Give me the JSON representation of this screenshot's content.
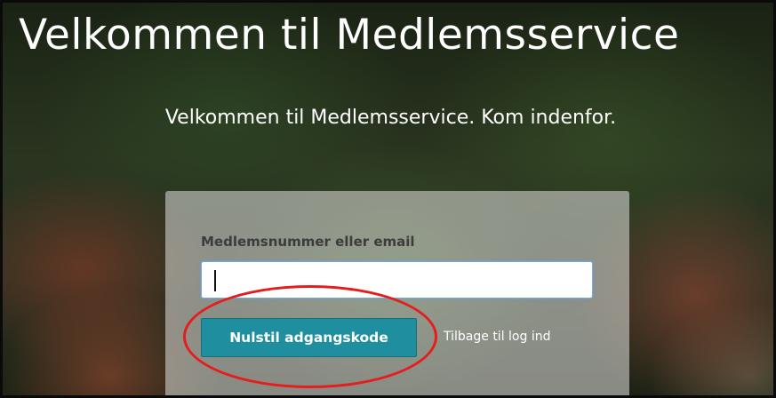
{
  "page": {
    "heading": "Velkommen til Medlemsservice",
    "subheading": "Velkommen til Medlemsservice. Kom indenfor."
  },
  "form": {
    "field_label": "Medlemsnummer eller email",
    "input_value": "",
    "reset_button_label": "Nulstil adgangskode",
    "back_link_label": "Tilbage til log ind"
  },
  "colors": {
    "button": "#1f8f9f",
    "highlight": "#e41e1e",
    "input_focus": "#7aa9d8"
  }
}
